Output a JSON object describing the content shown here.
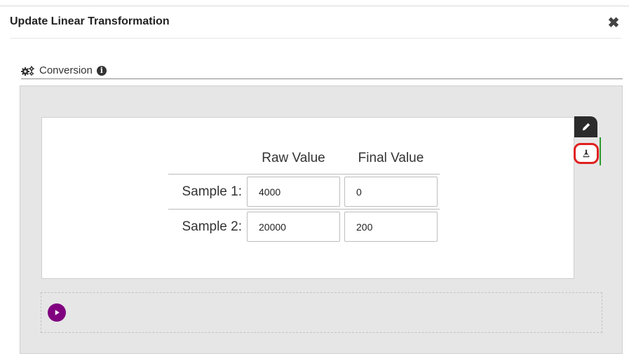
{
  "dialog": {
    "title": "Update Linear Transformation",
    "close_icon": "close-icon",
    "close_glyph": "✖"
  },
  "section": {
    "title": "Conversion",
    "icons": [
      "gears-icon",
      "info-icon"
    ],
    "info_glyph": "i"
  },
  "table": {
    "headers": [
      "Raw Value",
      "Final Value"
    ],
    "rows": [
      {
        "label": "Sample 1:",
        "raw": "4000",
        "final": "0"
      },
      {
        "label": "Sample 2:",
        "raw": "20000",
        "final": "200"
      }
    ]
  },
  "tools": {
    "edit_icon": "pencil-icon",
    "test_icon": "flask-icon",
    "highlight_color": "#e02020"
  },
  "footer": {
    "play_icon": "play-icon",
    "accent": "#800080"
  }
}
